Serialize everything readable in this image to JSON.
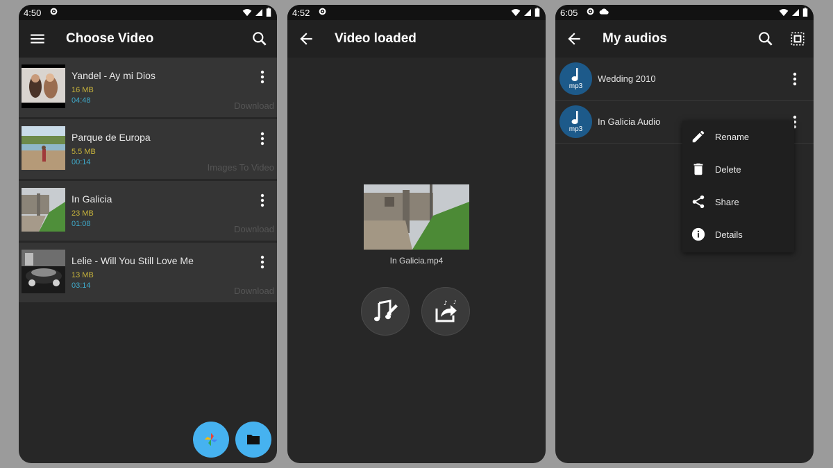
{
  "screen1": {
    "status_time": "4:50",
    "title": "Choose Video",
    "videos": [
      {
        "title": "Yandel - Ay mi Dios",
        "size": "16 MB",
        "duration": "04:48",
        "action": "Download"
      },
      {
        "title": "Parque de Europa",
        "size": "5.5 MB",
        "duration": "00:14",
        "action": "Images To Video"
      },
      {
        "title": "In Galicia",
        "size": "23 MB",
        "duration": "01:08",
        "action": "Download"
      },
      {
        "title": "Lelie - Will You Still Love Me",
        "size": "13 MB",
        "duration": "03:14",
        "action": "Download"
      }
    ],
    "fabs": [
      "photos-icon",
      "folder-icon"
    ]
  },
  "screen2": {
    "status_time": "4:52",
    "title": "Video loaded",
    "filename": "In Galicia.mp4",
    "actions": [
      "music-edit-icon",
      "share-audio-icon"
    ]
  },
  "screen3": {
    "status_time": "6:05",
    "title": "My audios",
    "audios": [
      {
        "title": "Wedding 2010",
        "format": "mp3"
      },
      {
        "title": "In Galicia Audio",
        "format": "mp3"
      }
    ],
    "menu": [
      {
        "label": "Rename",
        "icon": "pencil-icon"
      },
      {
        "label": "Delete",
        "icon": "trash-icon"
      },
      {
        "label": "Share",
        "icon": "share-icon"
      },
      {
        "label": "Details",
        "icon": "info-icon"
      }
    ]
  },
  "colors": {
    "size_text": "#c8b43c",
    "duration_text": "#3fa9c9",
    "fab": "#46b2f0",
    "avatar": "#1d5a8a"
  }
}
